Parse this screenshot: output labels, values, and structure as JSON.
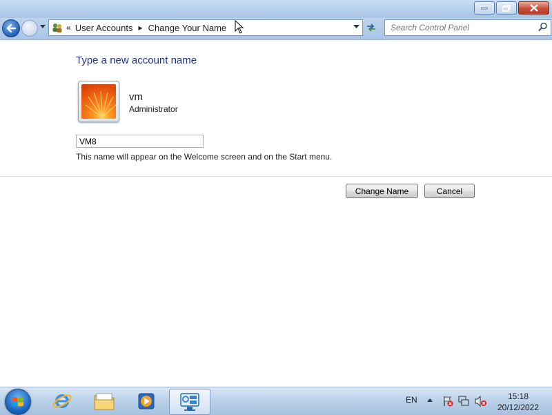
{
  "window": {
    "minimize_icon": "minimize-icon",
    "maximize_icon": "restore-icon",
    "close_icon": "close-icon"
  },
  "navigation": {
    "breadcrumb": {
      "overflow": "«",
      "items": [
        "User Accounts",
        "Change Your Name"
      ]
    },
    "search": {
      "placeholder": "Search Control Panel"
    }
  },
  "content": {
    "heading": "Type a new account name",
    "user": {
      "name": "vm",
      "role": "Administrator"
    },
    "name_input": {
      "value": "VM8"
    },
    "hint": "This name will appear on the Welcome screen and on the Start menu.",
    "buttons": {
      "change_name": "Change Name",
      "cancel": "Cancel"
    }
  },
  "taskbar": {
    "pinned": [
      "internet-explorer-icon",
      "windows-explorer-icon",
      "media-player-icon",
      "control-panel-icon"
    ],
    "tray": {
      "language": "EN",
      "time": "15:18",
      "date": "20/12/2022"
    }
  },
  "colors": {
    "heading": "#1e3287",
    "titlebar": "#b7d0ec",
    "close_button": "#c7503a"
  }
}
